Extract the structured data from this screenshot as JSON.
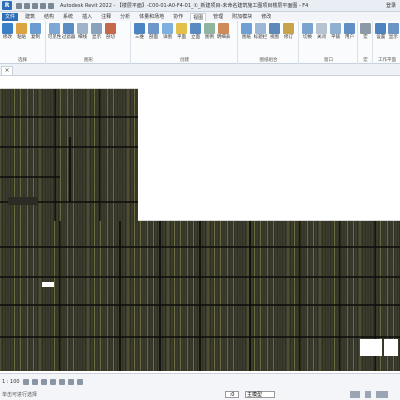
{
  "app": {
    "logo_text": "R",
    "title": "Autodesk Revit 2022 - 【楼层平面】-C00-01-A0-F4-01_①_新建项目-未命名建筑施工图项目楼层平面图 - F4",
    "user": "登录"
  },
  "tabs": [
    {
      "label": "文件",
      "kind": "file"
    },
    {
      "label": "建筑"
    },
    {
      "label": "结构"
    },
    {
      "label": "系统"
    },
    {
      "label": "插入"
    },
    {
      "label": "注释"
    },
    {
      "label": "分析"
    },
    {
      "label": "体量和场地"
    },
    {
      "label": "协作"
    },
    {
      "label": "视图",
      "kind": "active"
    },
    {
      "label": "管理"
    },
    {
      "label": "附加模块"
    },
    {
      "label": "修改"
    }
  ],
  "ribbon": {
    "group1": {
      "buttons": [
        {
          "label": "修改",
          "icon": "modify-icon"
        },
        {
          "label": "粘贴",
          "icon": "paste-icon"
        },
        {
          "label": "复制",
          "icon": "copy-icon"
        }
      ],
      "label": "选择"
    },
    "group2": {
      "dropdown": "图形",
      "buttons": [
        {
          "label": "可见性",
          "icon": "visibility-icon"
        },
        {
          "label": "过滤器",
          "icon": "filter-icon"
        },
        {
          "label": "细线",
          "icon": "thin-lines-icon"
        },
        {
          "label": "显示",
          "icon": "show-icon"
        },
        {
          "label": "剖切",
          "icon": "section-icon"
        }
      ],
      "label": "图形"
    },
    "group3": {
      "buttons": [
        {
          "label": "三维",
          "icon": "3d-view-icon"
        },
        {
          "label": "剖面",
          "icon": "section-view-icon"
        },
        {
          "label": "详图",
          "icon": "callout-icon"
        },
        {
          "label": "平面",
          "icon": "plan-view-icon"
        },
        {
          "label": "立面",
          "icon": "elevation-icon"
        },
        {
          "label": "图例",
          "icon": "legend-icon"
        },
        {
          "label": "明细表",
          "icon": "schedule-icon"
        }
      ],
      "label": "创建"
    },
    "group4": {
      "buttons": [
        {
          "label": "图纸",
          "icon": "sheet-icon"
        },
        {
          "label": "标题栏",
          "icon": "titleblock-icon"
        },
        {
          "label": "视图",
          "icon": "view-icon"
        },
        {
          "label": "修订",
          "icon": "revision-icon"
        }
      ],
      "label": "图纸组合"
    },
    "group5": {
      "buttons": [
        {
          "label": "切换",
          "icon": "switch-window-icon"
        },
        {
          "label": "关闭",
          "icon": "close-window-icon"
        },
        {
          "label": "平铺",
          "icon": "tile-icon"
        },
        {
          "label": "用户",
          "icon": "user-interface-icon"
        }
      ],
      "label": "窗口"
    },
    "group6": {
      "buttons": [
        {
          "label": "宏",
          "icon": "macro-icon"
        }
      ],
      "label": "宏"
    },
    "group7": {
      "buttons": [
        {
          "label": "设置",
          "icon": "settings-icon"
        },
        {
          "label": "显示",
          "icon": "display-icon"
        }
      ],
      "label": "工作平面"
    }
  },
  "colors": {
    "accent": "#2f6fb7",
    "plan_lines": "#1a1a1a",
    "plan_highlight": "#c8c86a"
  },
  "viewtab": {
    "close_glyph": "×"
  },
  "statusbar": {
    "scale": "1 : 100",
    "message": "单击可进行选择",
    "count": ":0",
    "model": "主模型"
  }
}
